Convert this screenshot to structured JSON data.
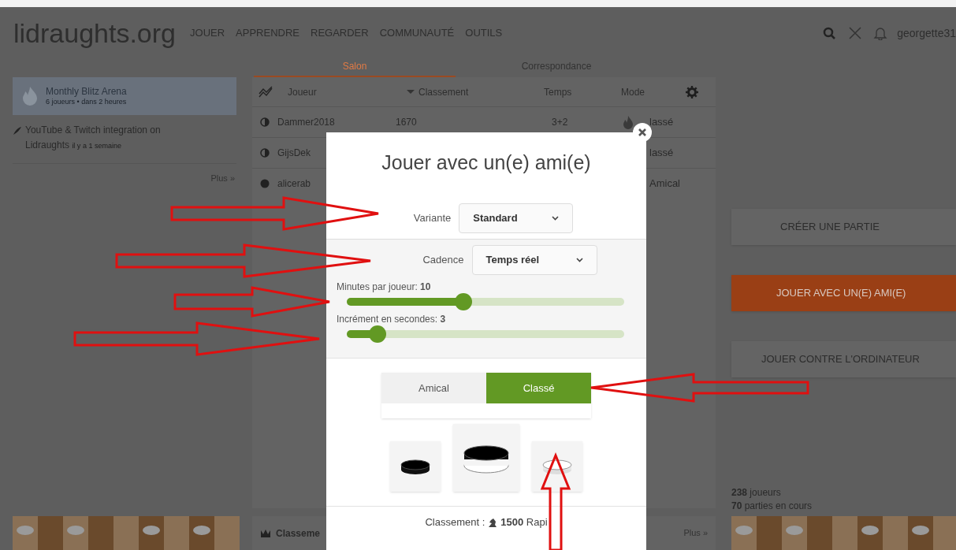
{
  "header": {
    "logo": "lidraughts.org",
    "nav": [
      "JOUER",
      "APPRENDRE",
      "REGARDER",
      "COMMUNAUTÉ",
      "OUTILS"
    ],
    "user": "georgette31"
  },
  "tabs": [
    {
      "label": "Salon",
      "selected": true
    },
    {
      "label": "Correspondance",
      "selected": false
    }
  ],
  "sidebar": {
    "event": {
      "title": "Monthly Blitz Arena",
      "subtitle": "6 joueurs • dans 2 heures"
    },
    "news": {
      "title": "YouTube & Twitch integration on Lidraughts",
      "time": "il y a 1 semaine"
    },
    "more": "Plus »"
  },
  "lobby": {
    "columns": [
      "Joueur",
      "Classement",
      "Temps",
      "Mode"
    ],
    "rows": [
      {
        "kind": "half",
        "player": "Dammer2018",
        "rating": "1670",
        "time": "3+2",
        "rated_icon": true,
        "mode": "lassé"
      },
      {
        "kind": "half",
        "player": "GijsDek",
        "mode": "lassé"
      },
      {
        "kind": "full",
        "player": "alicerab",
        "mode": "Amical"
      }
    ]
  },
  "actions": [
    {
      "label": "CRÉER UNE PARTIE",
      "selected": false
    },
    {
      "label": "JOUER AVEC UN(E) AMI(E)",
      "selected": true
    },
    {
      "label": "JOUER CONTRE L'ORDINATEUR",
      "selected": false
    }
  ],
  "stats": [
    "**238** joueurs",
    "**70** parties en cours"
  ],
  "leaderboard": {
    "title": "Classeme",
    "more": "Plus »"
  },
  "modal": {
    "title": "Jouer avec un(e) ami(e)",
    "selects": [
      {
        "label": "Variante",
        "value": "Standard"
      },
      {
        "label": "Cadence",
        "value": "Temps réel"
      }
    ],
    "sliders": [
      {
        "label": "Minutes par joueur: **10**",
        "level": 0.42
      },
      {
        "label": "Incrément en secondes: **3**",
        "level": 0.11
      }
    ],
    "modes": [
      {
        "label": "Amical",
        "selected": false
      },
      {
        "label": "Classé",
        "selected": true
      }
    ],
    "colors": [
      {
        "kind": "black"
      },
      {
        "kind": "random"
      },
      {
        "kind": "white"
      }
    ],
    "rating": "Classement : ",
    "rating_value": "**1500** Rapi"
  }
}
